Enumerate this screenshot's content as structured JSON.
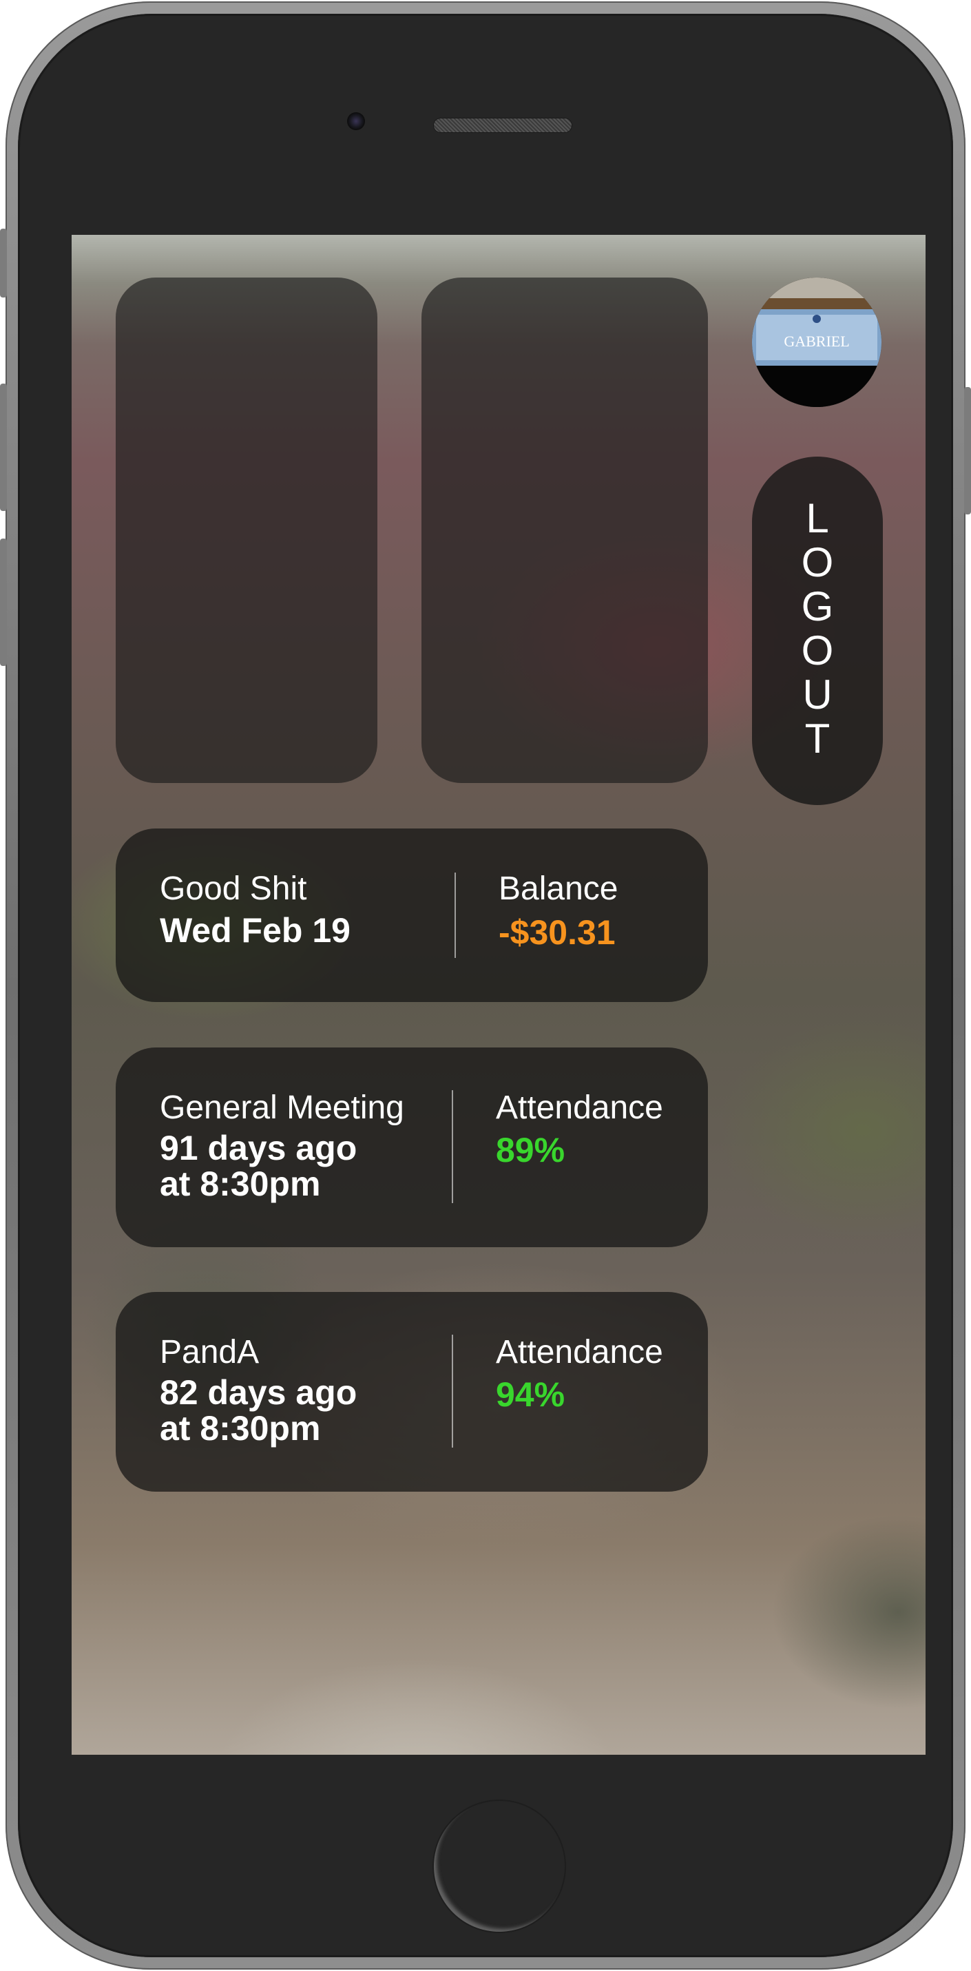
{
  "logout": {
    "letters": [
      "L",
      "O",
      "G",
      "O",
      "U",
      "T"
    ]
  },
  "avatar": {
    "sign_text": "GABRIEL"
  },
  "cards": [
    {
      "event": "Good Shit",
      "when": "Wed Feb 19",
      "metric_label": "Balance",
      "metric_value": "-$30.31",
      "metric_color": "#f7931e"
    },
    {
      "event": "General Meeting",
      "when": "91 days ago\nat 8:30pm",
      "metric_label": "Attendance",
      "metric_value": "89%",
      "metric_color": "#39d62d"
    },
    {
      "event": "PandA",
      "when": "82 days ago\nat 8:30pm",
      "metric_label": "Attendance",
      "metric_value": "94%",
      "metric_color": "#39d62d"
    }
  ]
}
